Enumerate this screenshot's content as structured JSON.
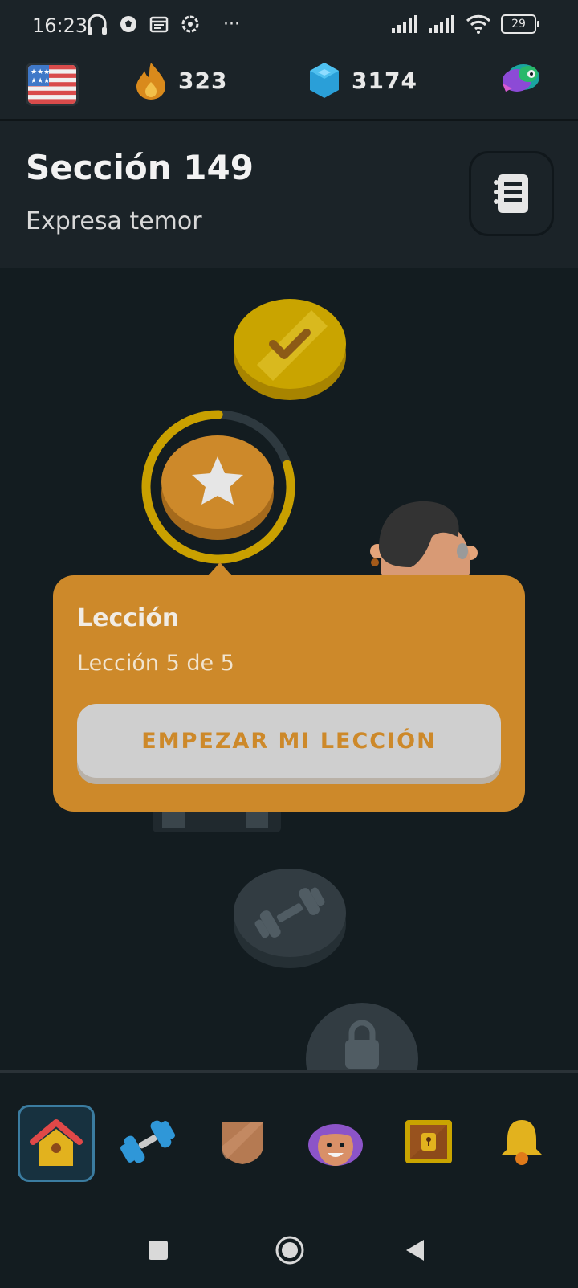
{
  "status_bar": {
    "time": "16:23",
    "more": "···",
    "battery": "29"
  },
  "stats": {
    "course_flag": "us-flag",
    "streak": "323",
    "gems": "3174"
  },
  "section": {
    "title": "Sección 149",
    "subtitle": "Expresa temor"
  },
  "popup": {
    "title": "Lección",
    "subtitle": "Lección 5 de 5",
    "button_label": "EMPEZAR MI LECCIÓN",
    "progress": 0.8
  },
  "nav": {
    "items": [
      "home-icon",
      "practice-dumbbell-icon",
      "league-shield-icon",
      "character-icon",
      "treasure-chest-icon",
      "bell-icon"
    ],
    "active": "home-icon"
  },
  "colors": {
    "accent": "#cd892a",
    "gold": "#c9a400",
    "background": "#131c20"
  }
}
